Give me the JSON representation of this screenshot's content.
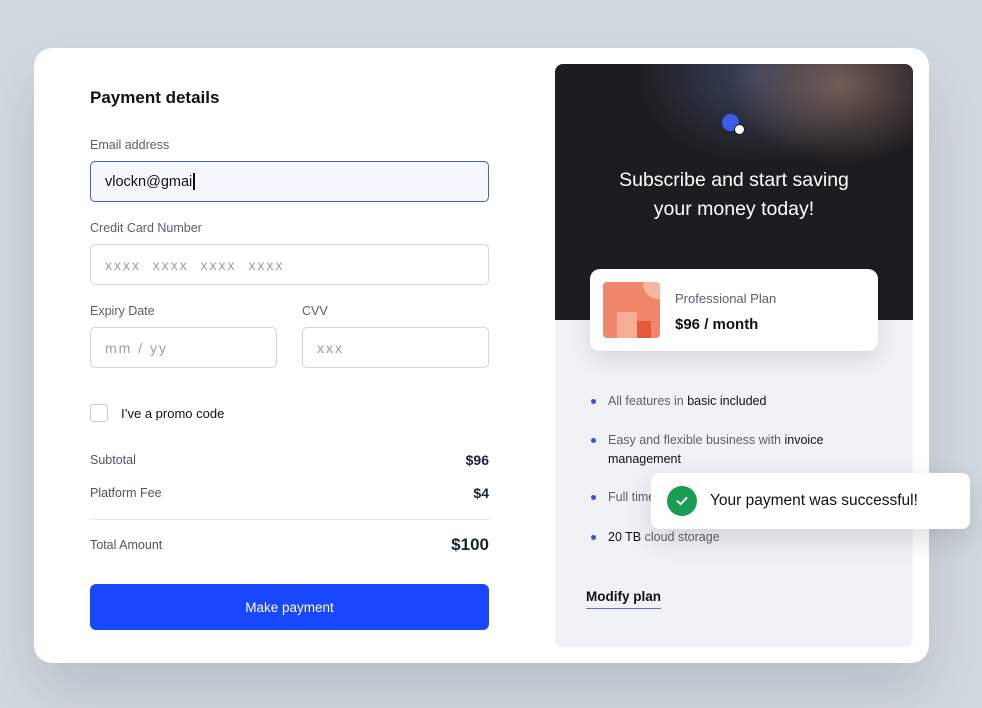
{
  "form": {
    "title": "Payment details",
    "email": {
      "label": "Email address",
      "value": "vlockn@gmai"
    },
    "card_number": {
      "label": "Credit Card Number",
      "placeholder": "xxxx  xxxx  xxxx  xxxx"
    },
    "expiry": {
      "label": "Expiry Date",
      "placeholder": "mm / yy"
    },
    "cvv": {
      "label": "CVV",
      "placeholder": "xxx"
    },
    "promo_label": "I’ve a promo code",
    "subtotal": {
      "label": "Subtotal",
      "value": "$96"
    },
    "platform_fee": {
      "label": "Platform Fee",
      "value": "$4"
    },
    "total": {
      "label": "Total Amount",
      "value": "$100"
    },
    "submit_label": "Make payment"
  },
  "promo": {
    "headline_line1": "Subscribe and start saving",
    "headline_line2": "your money today!",
    "plan_name": "Professional Plan",
    "plan_price": "$96 / month",
    "features": [
      {
        "pre": "All features in ",
        "em": "basic included",
        "post": ""
      },
      {
        "pre": "Easy and flexible business with ",
        "em": "invoice management",
        "post": ""
      },
      {
        "pre": "Full time",
        "em": "",
        "post": ""
      },
      {
        "pre": "",
        "em": "20 TB",
        "post": " cloud storage"
      }
    ],
    "modify_label": "Modify plan"
  },
  "toast": {
    "message": "Your payment was successful!"
  },
  "colors": {
    "accent": "#1847ff",
    "success": "#1a9c52",
    "plan_orange": "#f0876a"
  },
  "icons": {
    "logo": "brand-logo-icon",
    "checkmark": "check-icon",
    "bullet": "bullet-icon"
  }
}
